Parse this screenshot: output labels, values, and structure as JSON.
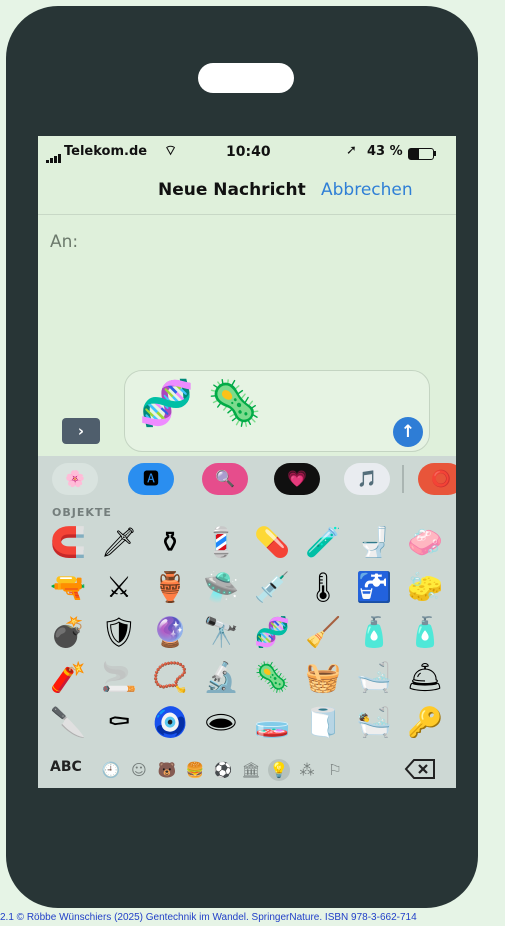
{
  "status_bar": {
    "carrier": "Telekom.de",
    "time": "10:40",
    "battery": "43 %",
    "battery_level": 0.43
  },
  "nav": {
    "title": "Neue Nachricht",
    "cancel_label": "Abbrechen"
  },
  "compose": {
    "to_label": "An:",
    "expand_icon": "›",
    "message_emojis": [
      "🧬",
      "🦠"
    ],
    "send_icon": "↑"
  },
  "app_strip": [
    {
      "name": "photos-app-icon",
      "glyph": "🌸",
      "bg": "#d9e3df"
    },
    {
      "name": "app-store-icon",
      "glyph": "🅰",
      "bg": "#2a8ef0"
    },
    {
      "name": "image-search-icon",
      "glyph": "🔍",
      "bg": "#e64d8c"
    },
    {
      "name": "digital-touch-icon",
      "glyph": "💗",
      "bg": "#101010"
    },
    {
      "name": "music-icon",
      "glyph": "🎵",
      "bg": "#e9ecf0"
    },
    {
      "name": "more-apps-icon",
      "glyph": "⭕",
      "bg": "#e8553a"
    }
  ],
  "keyboard": {
    "category_label": "OBJEKTE",
    "emojis": [
      [
        "🧲",
        "🗡",
        "⚱",
        "💈",
        "💊",
        "🧪",
        "🚽",
        "🧼"
      ],
      [
        "🔫",
        "⚔",
        "🏺",
        "🛸",
        "💉",
        "🌡",
        "🚰",
        "🧽"
      ],
      [
        "💣",
        "🛡",
        "🔮",
        "🔭",
        "🧬",
        "🧹",
        "🧴",
        "🧴"
      ],
      [
        "🧨",
        "🚬",
        "📿",
        "🔬",
        "🦠",
        "🧺",
        "🛁",
        "🛎"
      ],
      [
        "🔪",
        "⚰",
        "🧿",
        "🕳",
        "🧫",
        "🧻",
        "🛀",
        "🔑"
      ]
    ],
    "abc_label": "ABC",
    "categories": [
      {
        "name": "recent-icon",
        "glyph": "🕘"
      },
      {
        "name": "smileys-icon",
        "glyph": "☺"
      },
      {
        "name": "animals-icon",
        "glyph": "🐻"
      },
      {
        "name": "food-icon",
        "glyph": "🍔"
      },
      {
        "name": "activity-icon",
        "glyph": "⚽"
      },
      {
        "name": "travel-icon",
        "glyph": "🏛"
      },
      {
        "name": "objects-icon",
        "glyph": "💡",
        "active": true
      },
      {
        "name": "symbols-icon",
        "glyph": "⁂"
      },
      {
        "name": "flags-icon",
        "glyph": "⚐"
      }
    ]
  },
  "caption": "2.1 © Röbbe Wünschiers (2025) Gentechnik im Wandel. SpringerNature. ISBN 978-3-662-714"
}
